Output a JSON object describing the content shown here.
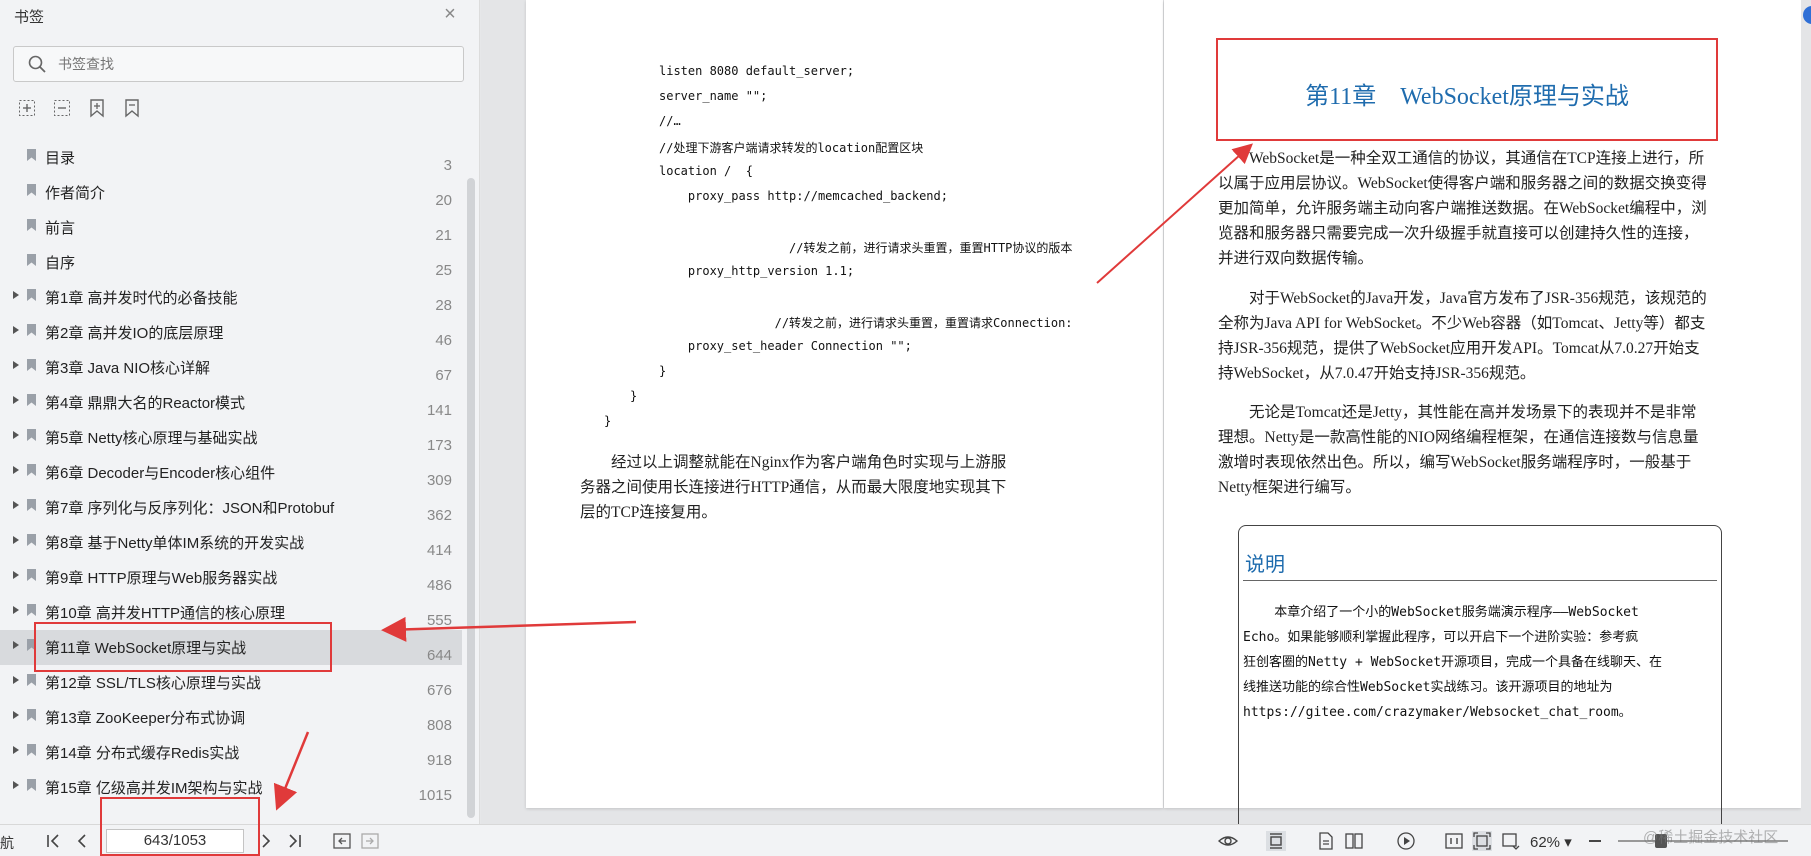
{
  "sidebar": {
    "title": "书签",
    "search_placeholder": "书签查找",
    "bookmarks": [
      {
        "label": "目录",
        "page": "3",
        "expandable": false
      },
      {
        "label": "作者简介",
        "page": "20",
        "expandable": false
      },
      {
        "label": "前言",
        "page": "21",
        "expandable": false
      },
      {
        "label": "自序",
        "page": "25",
        "expandable": false
      },
      {
        "label": "第1章 高并发时代的必备技能",
        "page": "28",
        "expandable": true
      },
      {
        "label": "第2章 高并发IO的底层原理",
        "page": "46",
        "expandable": true
      },
      {
        "label": "第3章 Java NIO核心详解",
        "page": "67",
        "expandable": true
      },
      {
        "label": "第4章 鼎鼎大名的Reactor模式",
        "page": "141",
        "expandable": true
      },
      {
        "label": "第5章 Netty核心原理与基础实战",
        "page": "173",
        "expandable": true
      },
      {
        "label": "第6章 Decoder与Encoder核心组件",
        "page": "309",
        "expandable": true
      },
      {
        "label": "第7章 序列化与反序列化：JSON和Protobuf",
        "page": "362",
        "expandable": true
      },
      {
        "label": "第8章 基于Netty单体IM系统的开发实战",
        "page": "414",
        "expandable": true
      },
      {
        "label": "第9章 HTTP原理与Web服务器实战",
        "page": "486",
        "expandable": true
      },
      {
        "label": "第10章 高并发HTTP通信的核心原理",
        "page": "555",
        "expandable": true
      },
      {
        "label": "第11章 WebSocket原理与实战",
        "page": "644",
        "expandable": true,
        "active": true
      },
      {
        "label": "第12章 SSL/TLS核心原理与实战",
        "page": "676",
        "expandable": true
      },
      {
        "label": "第13章 ZooKeeper分布式协调",
        "page": "808",
        "expandable": true
      },
      {
        "label": "第14章 分布式缓存Redis实战",
        "page": "918",
        "expandable": true
      },
      {
        "label": "第15章 亿级高并发IM架构与实战",
        "page": "1015",
        "expandable": true
      }
    ]
  },
  "left_page": {
    "code_lines": [
      "listen 8080 default_server;",
      "server_name \"\";",
      "//…",
      "//处理下游客户端请求转发的location配置区块",
      "location /  {",
      "    proxy_pass http://memcached_backend;",
      "                  //转发之前，进行请求头重置，重置HTTP协议的版本",
      "    proxy_http_version 1.1;",
      "                //转发之前，进行请求头重置，重置请求Connection:",
      "    proxy_set_header Connection \"\";",
      "}",
      "}",
      "}"
    ],
    "paragraph": "经过以上调整就能在Nginx作为客户端角色时实现与上游服务器之间使用长连接进行HTTP通信，从而最大限度地实现其下层的TCP连接复用。"
  },
  "right_page": {
    "chapter_title": "第11章　WebSocket原理与实战",
    "paragraphs": [
      "WebSocket是一种全双工通信的协议，其通信在TCP连接上进行，所以属于应用层协议。WebSocket使得客户端和服务器之间的数据交换变得更加简单，允许服务端主动向客户端推送数据。在WebSocket编程中，浏览器和服务器只需要完成一次升级握手就直接可以创建持久性的连接，并进行双向数据传输。",
      "对于WebSocket的Java开发，Java官方发布了JSR-356规范，该规范的全称为Java API for WebSocket。不少Web容器（如Tomcat、Jetty等）都支持JSR-356规范，提供了WebSocket应用开发API。Tomcat从7.0.27开始支持WebSocket，从7.0.47开始支持JSR-356规范。",
      "无论是Tomcat还是Jetty，其性能在高并发场景下的表现并不是非常理想。Netty是一款高性能的NIO网络编程框架，在通信连接数与信息量激增时表现依然出色。所以，编写WebSocket服务端程序时，一般基于Netty框架进行编写。"
    ],
    "note_title": "说明",
    "note_lines": [
      "    本章介绍了一个小的WebSocket服务端演示程序——WebSocket",
      "Echo。如果能够顺利掌握此程序，可以开启下一个进阶实验：参考疯",
      "狂创客圈的Netty + WebSocket开源项目，完成一个具备在线聊天、在",
      "线推送功能的综合性WebSocket实战练习。该开源项目的地址为",
      "https://gitee.com/crazymaker/Websocket_chat_room。"
    ]
  },
  "bottombar": {
    "nav_label": "航",
    "page_value": "643/1053",
    "zoom": "62%"
  },
  "watermark": "@稀土掘金技术社区",
  "colors": {
    "highlight_red": "#e03a3a",
    "chapter_blue": "#1f6cae",
    "sidebar_bg": "#f2f3f5",
    "active_row_bg": "#d8dadd"
  }
}
